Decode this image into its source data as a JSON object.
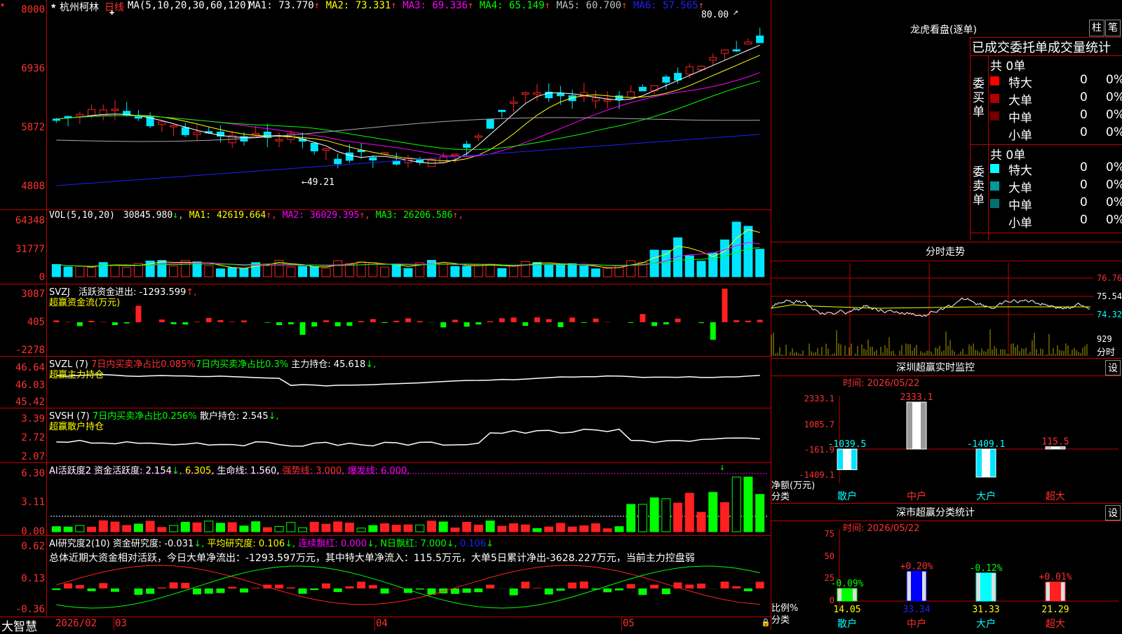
{
  "colors": {
    "up": "#ff2020",
    "down": "#00e5ff",
    "grid": "#c00000",
    "white": "#ffffff",
    "yellow": "#ffff00",
    "magenta": "#ff00ff",
    "green": "#00ff00",
    "blue": "#2020ff",
    "gray": "#aaaaaa",
    "cyan": "#00ffff",
    "vol_up": "#ff2020"
  },
  "price_panel": {
    "star": "★",
    "stock_name": "杭州柯林",
    "period": "日线",
    "ma_header": "MA(5,10,20,30,60,120)",
    "ma_values": [
      {
        "label": "MA1: 73.770",
        "arrow": "↑",
        "color": "#ffffff"
      },
      {
        "label": "MA2: 73.331",
        "arrow": "↑",
        "color": "#ffff00"
      },
      {
        "label": "MA3: 69.336",
        "arrow": "↑",
        "color": "#ff00ff"
      },
      {
        "label": "MA4: 65.149",
        "arrow": "↑",
        "color": "#00ff00"
      },
      {
        "label": "MA5: 60.700",
        "arrow": "↑",
        "color": "#c0c0c0"
      },
      {
        "label": "MA6: 57.565",
        "arrow": "↑",
        "color": "#2020ff"
      }
    ],
    "y_labels": [
      "8000",
      "6936",
      "5872",
      "4808"
    ],
    "high_annotation": "80.00",
    "low_annotation": "←49.21",
    "y_range": [
      45,
      80.5
    ]
  },
  "vol_panel": {
    "header": "VOL(5,10,20)",
    "value": "30845.980",
    "value_arrow": "↓",
    "ma": [
      {
        "label": "MA1: 42619.664",
        "arrow": "↑",
        "color": "#ffff00"
      },
      {
        "label": "MA2: 36029.395",
        "arrow": "↑",
        "color": "#ff00ff"
      },
      {
        "label": "MA3: 26206.586",
        "arrow": "↑",
        "color": "#00ff00"
      }
    ],
    "y_labels": [
      "64348",
      "31777",
      "0"
    ]
  },
  "svzj_panel": {
    "header": "SVZJ",
    "title": "活跃资金进出: ",
    "value": "-1293.599",
    "arrow": "↑,",
    "subtitle": "超赢资金流(万元)",
    "y_labels": [
      "3087",
      "405",
      "-2278"
    ]
  },
  "svzl_panel": {
    "header": "SVZL (7)",
    "t1": "7日内买卖净占比0.085%",
    "t2": "7日内买卖净占比0.3%",
    "t3": "主力持仓: 45.618",
    "arrow": "↓,",
    "subtitle": "超赢主力持仓",
    "y_labels": [
      "46.64",
      "46.03",
      "45.42"
    ]
  },
  "svsh_panel": {
    "header": "SVSH (7)",
    "t1": "7日内买卖净占比0.256%",
    "t2": "散户持仓: 2.545",
    "arrow": "↓,",
    "subtitle": "超赢散户持仓",
    "y_labels": [
      "3.39",
      "2.72",
      "2.07"
    ]
  },
  "ai_activity_panel": {
    "header": "AI活跃度2",
    "t1": "资金活跃度: 2.154",
    "a1": "↓,",
    "t2": "6.305,",
    "t3": "生命线: 1.560,",
    "t4": "强势线: 3.000,",
    "t5": "爆发线: 6.000,",
    "y_labels": [
      "6.30",
      "3.11",
      "0.00"
    ],
    "signal_arrow": "↓"
  },
  "ai_research_panel": {
    "header": "AI研究度2(10)",
    "t1": "资金研究度: -0.031",
    "a1": "↓,",
    "t2": "平均研究度: 0.106",
    "a2": "↓,",
    "t3": "连续飘红: 0.000",
    "a3": "↓,",
    "t4": "N日飘红: 7.000",
    "a4": "↓,",
    "t5": "0.106",
    "a5": "↓",
    "summary": "总体近期大资金相对活跃，今日大单净流出：-1293.597万元，其中特大单净流入：115.5万元，大单5日累计净出-3628.227万元，当前主力控盘弱",
    "y_labels": [
      "0.62",
      "0.13",
      "-0.36"
    ]
  },
  "x_axis": {
    "brand": "大智慧",
    "labels": [
      "2026/02",
      "03",
      "04",
      "05"
    ]
  },
  "longhu": {
    "title": "龙虎看盘(逐单)",
    "btn1": "柱",
    "btn2": "笔",
    "header": "已成交委托单成交量统计",
    "buy": {
      "side_label": "委买单",
      "total": "共 0单",
      "rows": [
        {
          "name": "特大",
          "value": "0",
          "pct": "0%",
          "color": "#ff0000"
        },
        {
          "name": "大单",
          "value": "0",
          "pct": "0%",
          "color": "#b00000"
        },
        {
          "name": "中单",
          "value": "0",
          "pct": "0%",
          "color": "#700000"
        },
        {
          "name": "小单",
          "value": "0",
          "pct": "0%",
          "color": ""
        }
      ]
    },
    "sell": {
      "side_label": "委卖单",
      "total": "共 0单",
      "rows": [
        {
          "name": "特大",
          "value": "0",
          "pct": "0%",
          "color": "#00ffff"
        },
        {
          "name": "大单",
          "value": "0",
          "pct": "0%",
          "color": "#009a9a"
        },
        {
          "name": "中单",
          "value": "0",
          "pct": "0%",
          "color": "#007070"
        },
        {
          "name": "小单",
          "value": "0",
          "pct": "0%",
          "color": ""
        }
      ]
    }
  },
  "intraday": {
    "title": "分时走势",
    "y_labels": [
      "76.76",
      "75.54",
      "74.32"
    ],
    "vol_label": "929",
    "vol_unit": "分时"
  },
  "monitor": {
    "title": "深圳超赢实时监控",
    "btn": "设",
    "time": "时间: 2026/05/22",
    "chart_data": {
      "type": "bar",
      "categories": [
        "散户",
        "中户",
        "大户",
        "超大"
      ],
      "values": [
        -1039.5,
        2333.1,
        -1409.1,
        115.5
      ],
      "value_labels": [
        "-1039.5",
        "2333.1",
        "-1409.1",
        "115.5"
      ],
      "y_labels": [
        "2333.1",
        "1085.7",
        "-161.9",
        "-1409.1"
      ],
      "ylim": [
        -1409.1,
        2333.1
      ]
    },
    "label1": "净额(万元)",
    "label2": "分类"
  },
  "category_stats": {
    "title": "深市超赢分类统计",
    "btn": "设",
    "time": "时间: 2026/05/22",
    "chart_data": {
      "type": "bar",
      "categories": [
        "散户",
        "中户",
        "大户",
        "超大"
      ],
      "values": [
        14.05,
        33.34,
        31.33,
        21.29
      ],
      "value_labels": [
        "14.05",
        "33.34",
        "31.33",
        "21.29"
      ],
      "changes": [
        "-0.09%",
        "+0.20%",
        "-0.12%",
        "+0.01%"
      ],
      "y_labels": [
        "75",
        "50",
        "25",
        "0"
      ],
      "ylim": [
        0,
        75
      ]
    },
    "label1": "比例%",
    "label2": "分类"
  }
}
